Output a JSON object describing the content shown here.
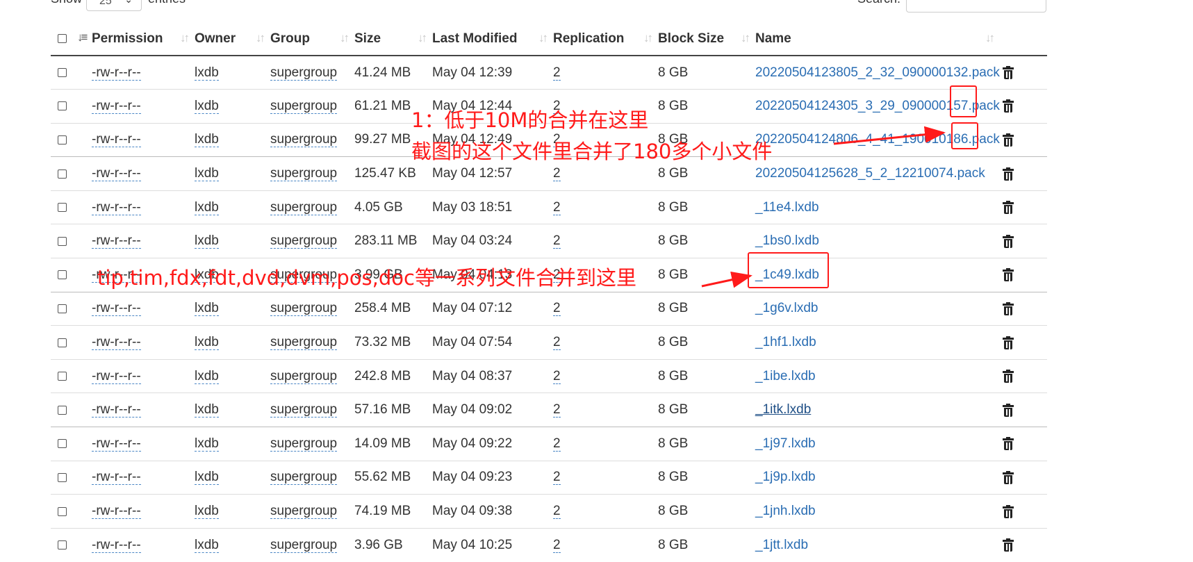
{
  "controls": {
    "show_label": "Show",
    "entries_value": "25",
    "entries_label": "entries",
    "search_label": "Search:",
    "search_value": ""
  },
  "columns": [
    "Permission",
    "Owner",
    "Group",
    "Size",
    "Last Modified",
    "Replication",
    "Block Size",
    "Name"
  ],
  "rows": [
    {
      "permission": "-rw-r--r--",
      "owner": "lxdb",
      "group": "supergroup",
      "size": "41.24 MB",
      "modified": "May 04 12:39",
      "replication": "2",
      "block_size": "8 GB",
      "name": "20220504123805_2_32_090000132.pack"
    },
    {
      "permission": "-rw-r--r--",
      "owner": "lxdb",
      "group": "supergroup",
      "size": "61.21 MB",
      "modified": "May 04 12:44",
      "replication": "2",
      "block_size": "8 GB",
      "name": "20220504124305_3_29_090000157.pack"
    },
    {
      "permission": "-rw-r--r--",
      "owner": "lxdb",
      "group": "supergroup",
      "size": "99.27 MB",
      "modified": "May 04 12:49",
      "replication": "2",
      "block_size": "8 GB",
      "name": "20220504124806_4_41_190010186.pack"
    },
    {
      "permission": "-rw-r--r--",
      "owner": "lxdb",
      "group": "supergroup",
      "size": "125.47 KB",
      "modified": "May 04 12:57",
      "replication": "2",
      "block_size": "8 GB",
      "name": "20220504125628_5_2_12210074.pack"
    },
    {
      "permission": "-rw-r--r--",
      "owner": "lxdb",
      "group": "supergroup",
      "size": "4.05 GB",
      "modified": "May 03 18:51",
      "replication": "2",
      "block_size": "8 GB",
      "name": "_11e4.lxdb"
    },
    {
      "permission": "-rw-r--r--",
      "owner": "lxdb",
      "group": "supergroup",
      "size": "283.11 MB",
      "modified": "May 04 03:24",
      "replication": "2",
      "block_size": "8 GB",
      "name": "_1bs0.lxdb"
    },
    {
      "permission": "-rw-r--r--",
      "owner": "lxdb",
      "group": "supergroup",
      "size": "3.99 GB",
      "modified": "May 04 04:13",
      "replication": "2",
      "block_size": "8 GB",
      "name": "_1c49.lxdb"
    },
    {
      "permission": "-rw-r--r--",
      "owner": "lxdb",
      "group": "supergroup",
      "size": "258.4 MB",
      "modified": "May 04 07:12",
      "replication": "2",
      "block_size": "8 GB",
      "name": "_1g6v.lxdb"
    },
    {
      "permission": "-rw-r--r--",
      "owner": "lxdb",
      "group": "supergroup",
      "size": "73.32 MB",
      "modified": "May 04 07:54",
      "replication": "2",
      "block_size": "8 GB",
      "name": "_1hf1.lxdb"
    },
    {
      "permission": "-rw-r--r--",
      "owner": "lxdb",
      "group": "supergroup",
      "size": "242.8 MB",
      "modified": "May 04 08:37",
      "replication": "2",
      "block_size": "8 GB",
      "name": "_1ibe.lxdb"
    },
    {
      "permission": "-rw-r--r--",
      "owner": "lxdb",
      "group": "supergroup",
      "size": "57.16 MB",
      "modified": "May 04 09:02",
      "replication": "2",
      "block_size": "8 GB",
      "name": "_1itk.lxdb"
    },
    {
      "permission": "-rw-r--r--",
      "owner": "lxdb",
      "group": "supergroup",
      "size": "14.09 MB",
      "modified": "May 04 09:22",
      "replication": "2",
      "block_size": "8 GB",
      "name": "_1j97.lxdb"
    },
    {
      "permission": "-rw-r--r--",
      "owner": "lxdb",
      "group": "supergroup",
      "size": "55.62 MB",
      "modified": "May 04 09:23",
      "replication": "2",
      "block_size": "8 GB",
      "name": "_1j9p.lxdb"
    },
    {
      "permission": "-rw-r--r--",
      "owner": "lxdb",
      "group": "supergroup",
      "size": "74.19 MB",
      "modified": "May 04 09:38",
      "replication": "2",
      "block_size": "8 GB",
      "name": "_1jnh.lxdb"
    },
    {
      "permission": "-rw-r--r--",
      "owner": "lxdb",
      "group": "supergroup",
      "size": "3.96 GB",
      "modified": "May 04 10:25",
      "replication": "2",
      "block_size": "8 GB",
      "name": "_1jtt.lxdb"
    }
  ],
  "annotations": {
    "note1_line1": "1：低于10M的合并在这里",
    "note1_line2": "截图的这个文件里合并了180多个小文件",
    "note2": "tip,tim,fdx,fdt,dvd,dvm,pos,doc等一系列文件合并到这里"
  },
  "colors": {
    "link": "#2a6db3",
    "annotation": "#ff1a1a",
    "header_rule": "#444444"
  }
}
